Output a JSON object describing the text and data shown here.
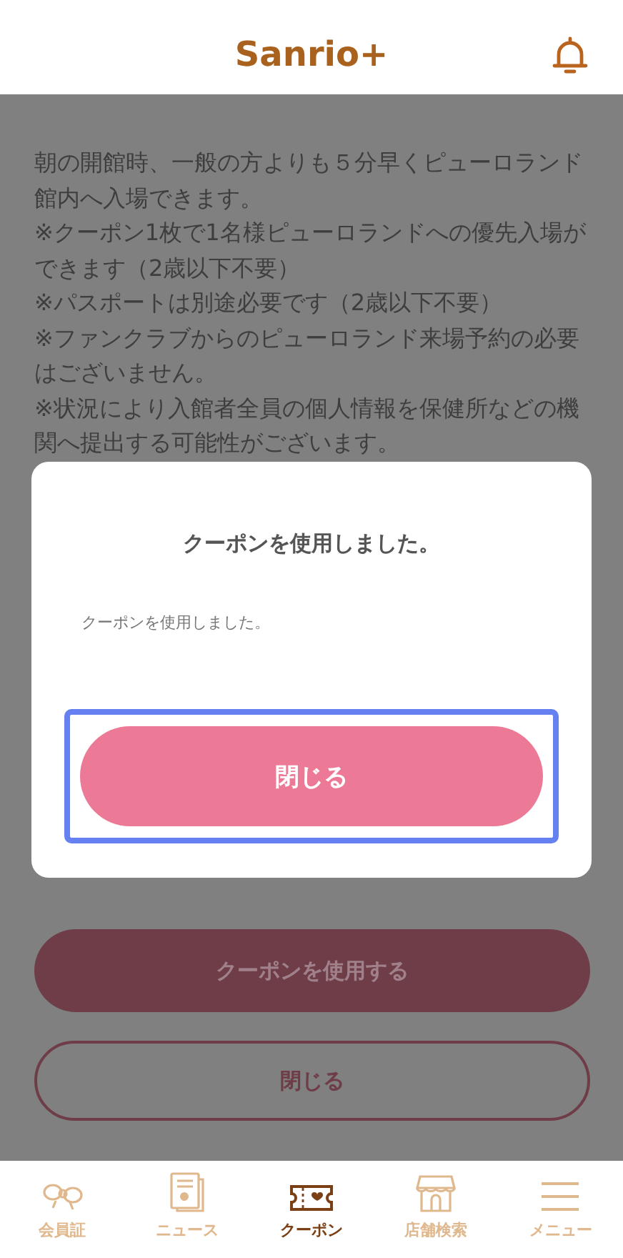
{
  "header": {
    "logo": "Sanrio+"
  },
  "body": {
    "lines": [
      "朝の開館時、一般の方よりも５分早くピューロランド館内へ入場できます。",
      "※クーポン1枚で1名様ピューロランドへの優先入場ができます（2歳以下不要）",
      "※パスポートは別途必要です（2歳以下不要）",
      "※ファンクラブからのピューロランド来場予約の必要はございません。",
      "※状況により入館者全員の個人情報を保健所などの機関へ提出する可能性がございます。"
    ]
  },
  "buttons": [
    {
      "label": "クーポンを使用する",
      "kind": "filled"
    },
    {
      "label": "閉じる",
      "kind": "outline"
    }
  ],
  "dialog": {
    "title": "クーポンを使用しました。",
    "message": "クーポンを使用しました。",
    "button": "閉じる"
  },
  "tabs": [
    {
      "label": "会員証",
      "kind": "ribbon",
      "selected": false
    },
    {
      "label": "ニュース",
      "kind": "news",
      "selected": false
    },
    {
      "label": "クーポン",
      "kind": "ticket",
      "selected": true
    },
    {
      "label": "店舗検索",
      "kind": "shop",
      "selected": false
    },
    {
      "label": "メニュー",
      "kind": "menu",
      "selected": false
    }
  ]
}
